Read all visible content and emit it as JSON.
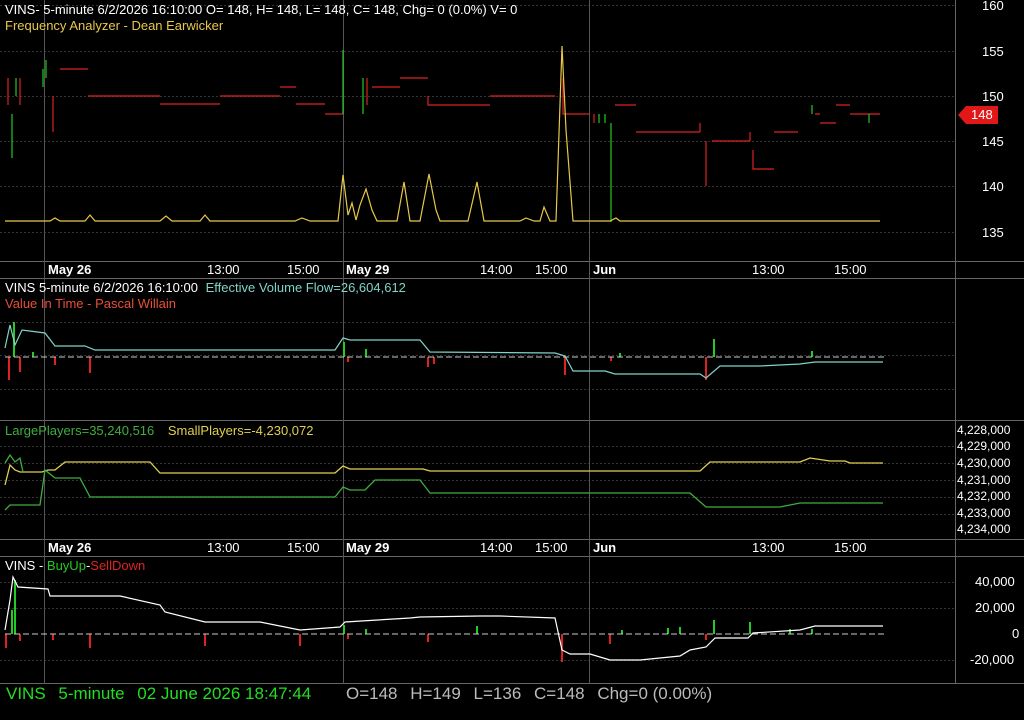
{
  "panel1": {
    "title_line": "VINS- 5-minute 6/2/2026 16:10:00 O= 148, H= 148, L= 148, C= 148, Chg= 0 (0.0%) V= 0",
    "indicator_name": "Frequency Analyzer - Dean Earwicker",
    "price_badge": "148",
    "y_ticks": [
      "160",
      "155",
      "150",
      "145",
      "140",
      "135"
    ]
  },
  "date_axis": {
    "labels": [
      "May 26",
      "13:00",
      "15:00",
      "May 29",
      "14:00",
      "15:00",
      "Jun",
      "13:00",
      "15:00"
    ]
  },
  "panel2": {
    "prefix": "VINS 5-minute  6/2/2026 16:10:00",
    "indicator": "Effective Volume Flow=26,604,612",
    "sub_indicator": "Value In Time - Pascal Willain"
  },
  "panel3": {
    "large_players": "LargePlayers=35,240,516",
    "small_players": "SmallPlayers=-4,230,072",
    "y_ticks": [
      "4,228,000",
      "4,229,000",
      "4,230,000",
      "4,231,000",
      "4,232,000",
      "4,233,000",
      "4,234,000"
    ]
  },
  "panel4": {
    "prefix": "VINS - ",
    "buy_up": "BuyUp",
    "dash": "-",
    "sell_down": "SellDown",
    "y_ticks": [
      "40,000",
      "20,000",
      "0",
      "-20,000"
    ]
  },
  "status_bar": {
    "symbol": "VINS",
    "interval": "5-minute",
    "datetime": "02 June 2026 18:47:44",
    "open": "O=148",
    "high": "H=149",
    "low": "L=136",
    "close": "C=148",
    "change": "Chg=0 (0.00%)"
  },
  "colors": {
    "background": "#000000",
    "grid": "#333333",
    "up": "#22cc22",
    "down": "#dd2222",
    "frequency": "#e8c84a",
    "volume_flow": "#7fd4c8",
    "large_players": "#3fae3f",
    "small_players": "#e0d050",
    "buy_sell_line": "#ffffff",
    "status_green": "#22dd22",
    "status_gray": "#bbbbbb",
    "badge": "#e01818"
  }
}
